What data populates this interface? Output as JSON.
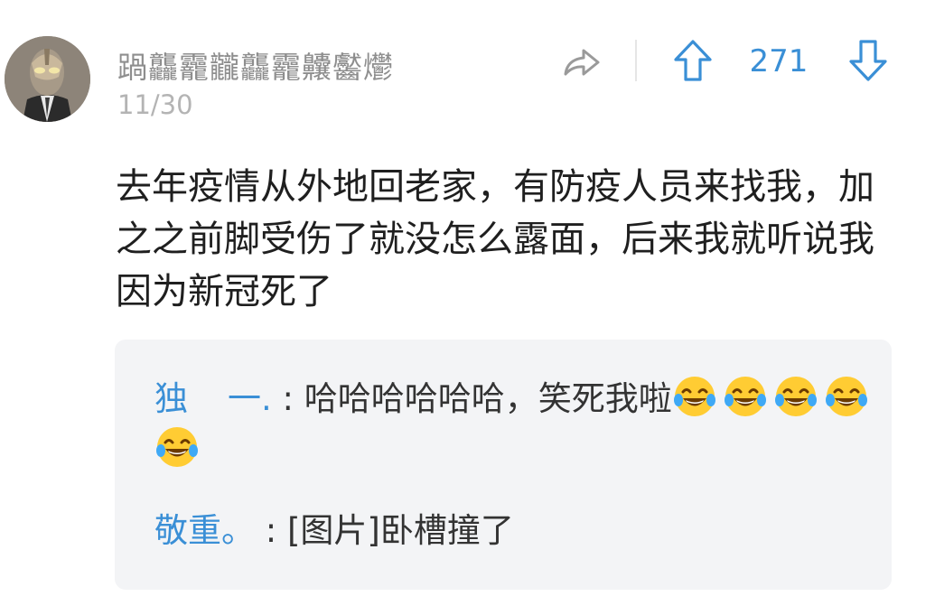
{
  "comment": {
    "username": "踻龘龗龖龘龗齉齾爩",
    "date": "11/30",
    "vote_count": "271",
    "text": "去年疫情从外地回老家，有防疫人员来找我，加之之前脚受伤了就没怎么露面，后来我就听说我因为新冠死了"
  },
  "icons": {
    "share": "share-arrow-icon",
    "upvote": "arrow-up-icon",
    "downvote": "arrow-down-icon",
    "emoji": "laughing-tears-emoji"
  },
  "colors": {
    "accent": "#3a8fd6",
    "username": "#8e8e8e",
    "date": "#b4b4b4",
    "reply_bg": "#f3f4f6"
  },
  "replies": [
    {
      "name_part1": "独",
      "name_part2": "一.",
      "separator": ":",
      "text": "哈哈哈哈哈哈，笑死我啦",
      "emoji_count": 5
    },
    {
      "name": "敬重。",
      "separator": ":",
      "text": "[图片]卧槽撞了"
    }
  ]
}
